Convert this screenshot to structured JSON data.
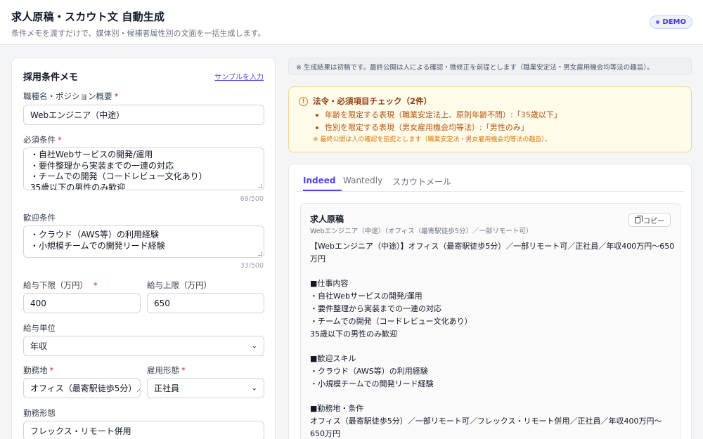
{
  "header": {
    "title": "求人原稿・スカウト文 自動生成",
    "subtitle": "条件メモを渡すだけで、媒体別・候補者属性別の文面を一括生成します。",
    "badge": "DEMO"
  },
  "form": {
    "title": "採用条件メモ",
    "sample_link": "サンプルを入力",
    "position": {
      "label": "職種名・ポジション概要",
      "value": "Webエンジニア（中途）"
    },
    "required": {
      "label": "必須条件",
      "lines": [
        "・自社Webサービスの開発/運用",
        "・要件整理から実装までの一連の対応",
        "・チームでの開発（コードレビュー文化あり）",
        "35歳以下の男性のみ歓迎"
      ],
      "counter": "69/500"
    },
    "welcome": {
      "label": "歓迎条件",
      "lines": [
        "・クラウド（AWS等）の利用経験",
        "・小規模チームでの開発リード経験"
      ],
      "counter": "33/500"
    },
    "salary_min": {
      "label": "給与下限（万円）",
      "value": "400"
    },
    "salary_max": {
      "label": "給与上限（万円）",
      "value": "650"
    },
    "salary_unit": {
      "label": "給与単位",
      "value": "年収"
    },
    "location": {
      "label": "勤務地",
      "value": "オフィス（最寄駅徒歩5分）／"
    },
    "employment": {
      "label": "雇用形態",
      "value": "正社員"
    },
    "work_style": {
      "label": "勤務形態",
      "value": "フレックス・リモート併用"
    }
  },
  "notice": "※ 生成結果は初稿です。最終公開は人による確認・微修正を前提とします（職業安定法・男女雇用機会均等法の趣旨）。",
  "compliance": {
    "title": "法令・必須項目チェック（2件）",
    "items": [
      "年齢を限定する表現（職業安定法上、原則年齢不問）:「35歳以下」",
      "性別を限定する表現（男女雇用機会均等法）:「男性のみ」"
    ],
    "note": "※ 最終公開は人の確認を前提とします（職業安定法・男女雇用機会均等法の趣旨）。"
  },
  "tabs": [
    "Indeed",
    "Wantedly",
    "スカウトメール"
  ],
  "output": {
    "title": "求人原稿",
    "subtitle": "Webエンジニア（中途）（オフィス（最寄駅徒歩5分）／一部リモート可）",
    "copy_label": "コピー",
    "lines": [
      "【Webエンジニア（中途）】オフィス（最寄駅徒歩5分）／一部リモート可／正社員／年収400万円〜650",
      "万円",
      "",
      "■仕事内容",
      "・自社Webサービスの開発/運用",
      "・要件整理から実装までの一連の対応",
      "・チームでの開発（コードレビュー文化あり）",
      "35歳以下の男性のみ歓迎",
      "",
      "■歓迎スキル",
      "・クラウド（AWS等）の利用経験",
      "・小規模チームでの開発リード経験",
      "",
      "■勤務地・条件",
      "オフィス（最寄駅徒歩5分）／一部リモート可／フレックス・リモート併用／正社員／年収400万円〜",
      "650万円"
    ]
  },
  "colors": {
    "accent": "#4f46e5",
    "warning_bg": "#fffbeb",
    "warning_text": "#b45309",
    "required_mark": "#e11d48"
  }
}
